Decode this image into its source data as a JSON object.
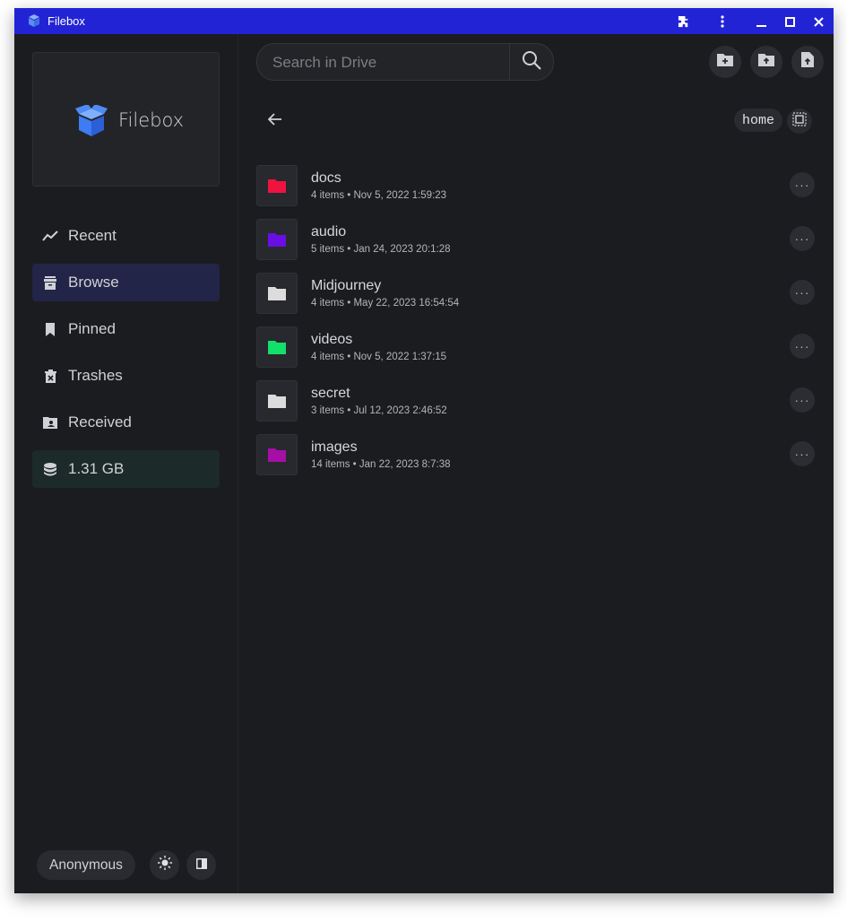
{
  "window": {
    "title": "Filebox",
    "titlebar_color": "#2323d6"
  },
  "titlebar_icons": [
    "puzzle-icon",
    "kebab-icon",
    "minimize-icon",
    "maximize-icon",
    "close-icon"
  ],
  "logo": {
    "text": "Filebox",
    "icon": "box-icon",
    "color": "#3d7cf2"
  },
  "nav": {
    "items": [
      {
        "label": "Recent",
        "icon": "trend-icon"
      },
      {
        "label": "Browse",
        "icon": "archive-icon",
        "active": true
      },
      {
        "label": "Pinned",
        "icon": "bookmark-icon"
      },
      {
        "label": "Trashes",
        "icon": "trash-icon"
      },
      {
        "label": "Received",
        "icon": "contact-icon"
      },
      {
        "label": "1.31 GB",
        "icon": "database-icon"
      }
    ]
  },
  "user": {
    "name": "Anonymous"
  },
  "search": {
    "placeholder": "Search in Drive",
    "value": ""
  },
  "breadcrumb": {
    "label": "home"
  },
  "actions": [
    "new-folder-icon",
    "upload-folder-icon",
    "upload-file-icon"
  ],
  "folders": [
    {
      "name": "docs",
      "meta": "4 items • Nov 5, 2022 1:59:23",
      "color": "#f0123f"
    },
    {
      "name": "audio",
      "meta": "5 items • Jan 24, 2023 20:1:28",
      "color": "#6a0ee6"
    },
    {
      "name": "Midjourney",
      "meta": "4 items • May 22, 2023 16:54:54",
      "color": "#dcdcdc"
    },
    {
      "name": "videos",
      "meta": "4 items • Nov 5, 2022 1:37:15",
      "color": "#12e06a"
    },
    {
      "name": "secret",
      "meta": "3 items • Jul 12, 2023 2:46:52",
      "color": "#dcdcdc"
    },
    {
      "name": "images",
      "meta": "14 items • Jan 22, 2023 8:7:38",
      "color": "#a60fa6"
    }
  ],
  "more_label": "···"
}
